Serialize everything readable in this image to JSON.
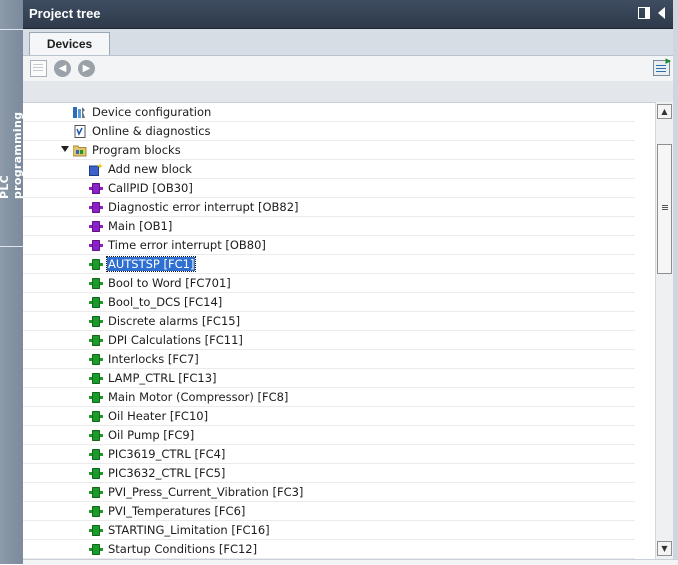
{
  "panel": {
    "title": "Project tree",
    "side_label": "PLC programming"
  },
  "tabs": [
    {
      "label": "Devices"
    }
  ],
  "toolbar": {
    "icons": [
      "new-folder-icon",
      "back-icon",
      "forward-icon",
      "details-view-icon"
    ]
  },
  "tree": {
    "items": [
      {
        "label": "Device configuration",
        "icon": "device-configuration-icon"
      },
      {
        "label": "Online & diagnostics",
        "icon": "online-diagnostics-icon"
      },
      {
        "label": "Program blocks",
        "icon": "folder-icon",
        "expanded": true
      },
      {
        "label": "Add new block",
        "icon": "add-block-icon"
      },
      {
        "label": "CallPID [OB30]",
        "icon": "organization-block-icon"
      },
      {
        "label": "Diagnostic error interrupt [OB82]",
        "icon": "organization-block-icon"
      },
      {
        "label": "Main [OB1]",
        "icon": "organization-block-icon"
      },
      {
        "label": "Time error interrupt [OB80]",
        "icon": "organization-block-icon"
      },
      {
        "label": "AUTSTSP [FC1]",
        "icon": "function-block-icon",
        "selected": true
      },
      {
        "label": "Bool to Word [FC701]",
        "icon": "function-block-icon"
      },
      {
        "label": "Bool_to_DCS [FC14]",
        "icon": "function-block-icon"
      },
      {
        "label": "Discrete alarms [FC15]",
        "icon": "function-block-icon"
      },
      {
        "label": "DPI Calculations [FC11]",
        "icon": "function-block-icon"
      },
      {
        "label": "Interlocks [FC7]",
        "icon": "function-block-icon"
      },
      {
        "label": "LAMP_CTRL [FC13]",
        "icon": "function-block-icon"
      },
      {
        "label": "Main Motor (Compressor) [FC8]",
        "icon": "function-block-icon"
      },
      {
        "label": "Oil Heater [FC10]",
        "icon": "function-block-icon"
      },
      {
        "label": "Oil Pump [FC9]",
        "icon": "function-block-icon"
      },
      {
        "label": "PIC3619_CTRL [FC4]",
        "icon": "function-block-icon"
      },
      {
        "label": "PIC3632_CTRL [FC5]",
        "icon": "function-block-icon"
      },
      {
        "label": "PVI_Press_Current_Vibration [FC3]",
        "icon": "function-block-icon"
      },
      {
        "label": "PVI_Temperatures [FC6]",
        "icon": "function-block-icon"
      },
      {
        "label": "STARTING_Limitation [FC16]",
        "icon": "function-block-icon"
      },
      {
        "label": "Startup Conditions [FC12]",
        "icon": "function-block-icon"
      }
    ]
  },
  "colors": {
    "title_bar": "#2e3a4b",
    "selection": "#2e6fd1",
    "ob_block": "#8e21c6",
    "fc_block": "#1c9a2a"
  }
}
